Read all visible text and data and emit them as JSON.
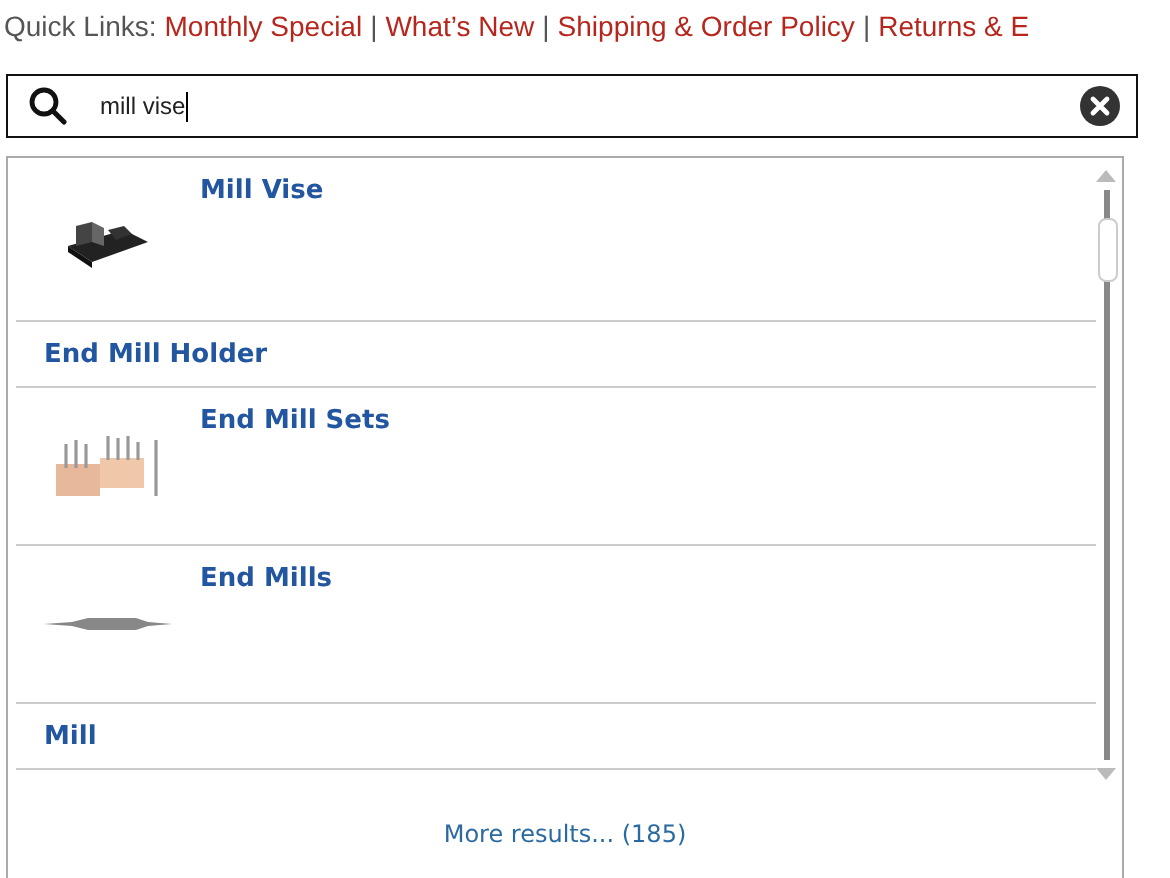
{
  "quick_links": {
    "label": "Quick Links:",
    "separator": "|",
    "links": [
      "Monthly Special",
      "What’s New",
      "Shipping & Order Policy",
      "Returns & E"
    ]
  },
  "search": {
    "value": "mill vise"
  },
  "results": [
    {
      "kind": "product",
      "title": "Mill Vise"
    },
    {
      "kind": "category",
      "title": "End Mill Holder"
    },
    {
      "kind": "product",
      "title": "End Mill Sets"
    },
    {
      "kind": "product",
      "title": "End Mills"
    },
    {
      "kind": "category",
      "title": "Mill"
    }
  ],
  "more_results": "More results... (185)"
}
